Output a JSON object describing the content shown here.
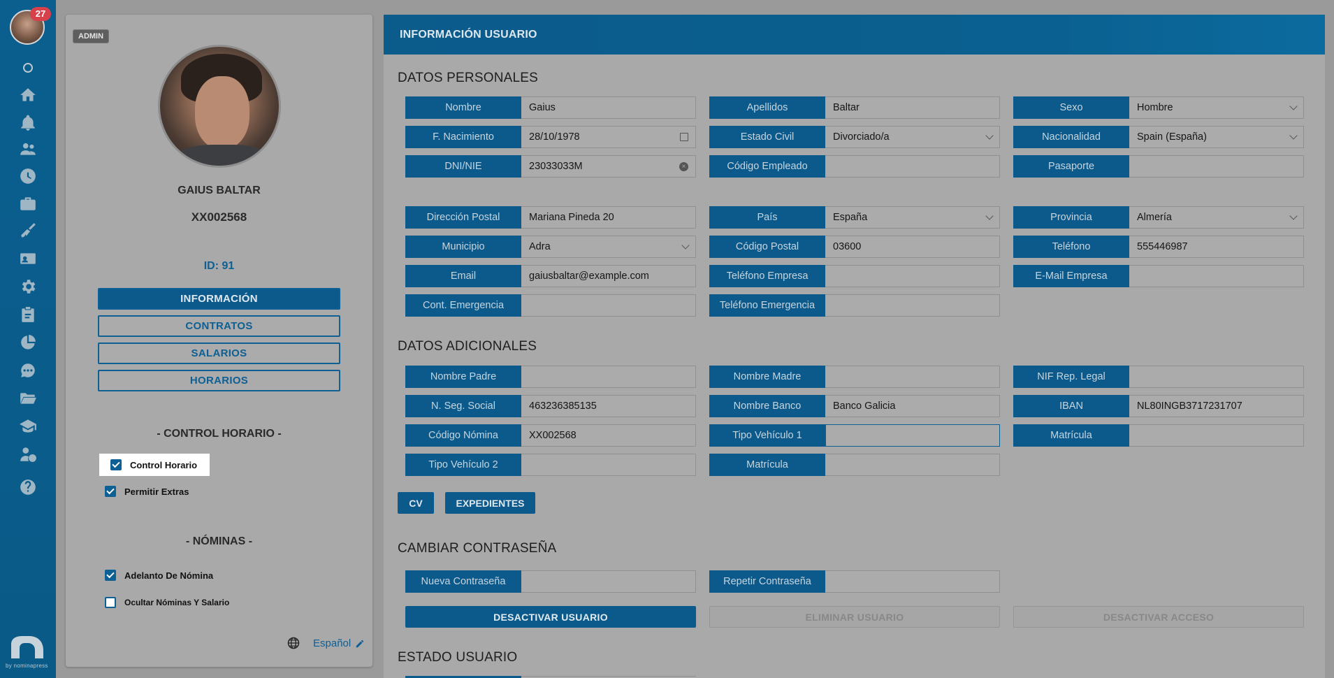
{
  "rail": {
    "notification_count": "27",
    "icons": [
      "status-dot",
      "home-icon",
      "bell-icon",
      "users-icon",
      "clock-icon",
      "briefcase-icon",
      "broom-icon",
      "id-card-icon",
      "gear-icon",
      "clipboard-icon",
      "pie-chart-icon",
      "chat-icon",
      "folder-icon",
      "graduation-cap-icon",
      "user-money-icon",
      "help-icon"
    ],
    "brand_by": "by nominapress"
  },
  "profile": {
    "role_badge": "ADMIN",
    "name": "GAIUS BALTAR",
    "code": "XX002568",
    "id_text": "ID: 91",
    "nav": [
      "INFORMACIÓN",
      "CONTRATOS",
      "SALARIOS",
      "HORARIOS"
    ],
    "control_title": "- CONTROL HORARIO -",
    "control_checks": [
      {
        "label": "Control Horario",
        "checked": true
      },
      {
        "label": "Permitir Extras",
        "checked": true
      }
    ],
    "payroll_title": "- NÓMINAS -",
    "payroll_checks": [
      {
        "label": "Adelanto De Nómina",
        "checked": true
      },
      {
        "label": "Ocultar Nóminas Y Salario",
        "checked": false
      }
    ],
    "language": "Español"
  },
  "panel": {
    "header": "INFORMACIÓN USUARIO",
    "personal_title": "DATOS PERSONALES",
    "personal": [
      {
        "label": "Nombre",
        "value": "Gaius"
      },
      {
        "label": "Apellidos",
        "value": "Baltar"
      },
      {
        "label": "Sexo",
        "value": "Hombre"
      },
      {
        "label": "F. Nacimiento",
        "value": "28/10/1978"
      },
      {
        "label": "Estado Civil",
        "value": "Divorciado/a"
      },
      {
        "label": "Nacionalidad",
        "value": "Spain (España)"
      },
      {
        "label": "DNI/NIE",
        "value": "23033033M"
      },
      {
        "label": "Código Empleado",
        "value": ""
      },
      {
        "label": "Pasaporte",
        "value": ""
      },
      {
        "label": "Dirección Postal",
        "value": "Mariana Pineda 20"
      },
      {
        "label": "País",
        "value": "España"
      },
      {
        "label": "Provincia",
        "value": "Almería"
      },
      {
        "label": "Municipio",
        "value": "Adra"
      },
      {
        "label": "Código Postal",
        "value": "03600"
      },
      {
        "label": "Teléfono",
        "value": "555446987"
      },
      {
        "label": "Email",
        "value": "gaiusbaltar@example.com"
      },
      {
        "label": "Teléfono Empresa",
        "value": ""
      },
      {
        "label": "E-Mail Empresa",
        "value": ""
      },
      {
        "label": "Cont. Emergencia",
        "value": ""
      },
      {
        "label": "Teléfono Emergencia",
        "value": ""
      }
    ],
    "additional_title": "DATOS ADICIONALES",
    "additional": [
      {
        "label": "Nombre Padre",
        "value": ""
      },
      {
        "label": "Nombre Madre",
        "value": ""
      },
      {
        "label": "NIF Rep. Legal",
        "value": ""
      },
      {
        "label": "N. Seg. Social",
        "value": "463236385135"
      },
      {
        "label": "Nombre Banco",
        "value": "Banco Galicia"
      },
      {
        "label": "IBAN",
        "value": "NL80INGB3717231707"
      },
      {
        "label": "Código Nómina",
        "value": "XX002568"
      },
      {
        "label": "Tipo Vehículo 1",
        "value": ""
      },
      {
        "label": "Matrícula",
        "value": ""
      },
      {
        "label": "Tipo Vehículo 2",
        "value": ""
      },
      {
        "label": "Matrícula",
        "value": ""
      }
    ],
    "doc_buttons": [
      "CV",
      "EXPEDIENTES"
    ],
    "password_title": "CAMBIAR CONTRASEÑA",
    "password": [
      {
        "label": "Nueva Contraseña",
        "value": ""
      },
      {
        "label": "Repetir Contraseña",
        "value": ""
      }
    ],
    "actions": [
      "DESACTIVAR USUARIO",
      "ELIMINAR USUARIO",
      "DESACTIVAR ACCESO"
    ],
    "status_title": "ESTADO USUARIO"
  }
}
